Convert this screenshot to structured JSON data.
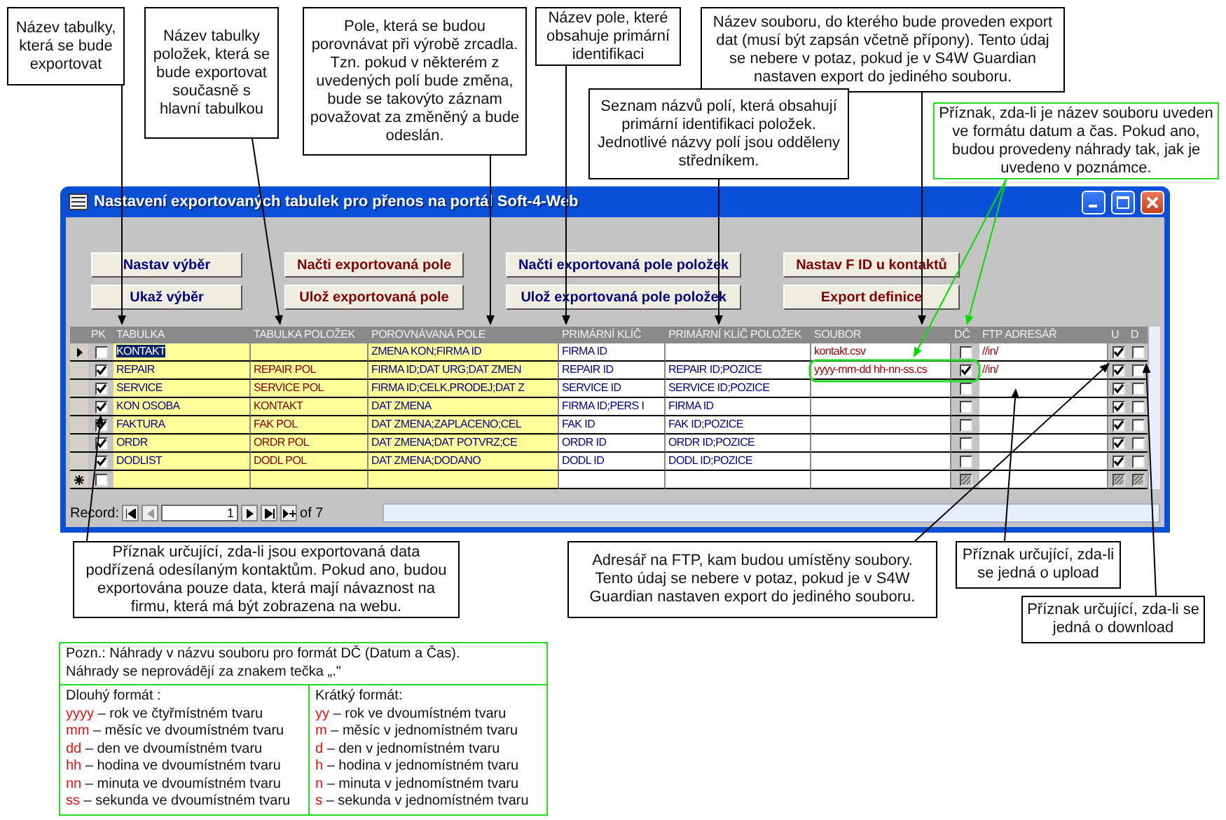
{
  "top_callouts": [
    {
      "text": "Název tabulky, která se bude exportovat",
      "kind": "plain"
    },
    {
      "text": "Název tabulky položek, která se bude exportovat současně s hlavní tabulkou",
      "kind": "plain"
    },
    {
      "text": "Pole, která se budou porovnávat při výrobě zrcadla. Tzn. pokud v některém z uvedených polí bude změna, bude se takovýto záznam považovat za změněný a bude odeslán.",
      "kind": "plain"
    },
    {
      "text": "Název pole, které obsahuje primární identifikaci",
      "kind": "plain"
    },
    {
      "text": "Název souboru, do kterého bude proveden export dat (musí být zapsán včetně přípony). Tento údaj se nebere v potaz, pokud je v S4W Guardian nastaven export do jediného souboru.",
      "kind": "plain"
    },
    {
      "text": "Seznam názvů polí, která obsahují primární identifikaci položek. Jednotlivé názvy polí jsou odděleny středníkem.",
      "kind": "plain"
    },
    {
      "text": "Příznak, zda-li je název souboru uveden ve formátu datum a čas. Pokud ano, budou provedeny náhrady tak, jak je uvedeno v poznámce.",
      "kind": "highlight"
    }
  ],
  "window": {
    "title": "Nastavení exportovaných tabulek pro přenos na portál Soft-4-Web",
    "buttons": [
      {
        "label": "Nastav výběr",
        "color": "#000080"
      },
      {
        "label": "Ukaž výběr",
        "color": "#000080"
      },
      {
        "label": "Načti exportovaná pole",
        "color": "#800000"
      },
      {
        "label": "Ulož exportovaná pole",
        "color": "#800000"
      },
      {
        "label": "Načti exportovaná pole položek",
        "color": "#000080"
      },
      {
        "label": "Ulož exportovaná pole položek",
        "color": "#000080"
      },
      {
        "label": "Nastav F ID u kontaktů",
        "color": "#800000"
      },
      {
        "label": "Export definice",
        "color": "#800000"
      }
    ],
    "table": {
      "columns": [
        "PK",
        "TABULKA",
        "TABULKA POLOŽEK",
        "POROVNÁVANÁ POLE",
        "PRIMÁRNÍ KLÍČ",
        "PRIMÁRNÍ KLÍČ POLOŽEK",
        "SOUBOR",
        "DČ",
        "FTP ADRESÁŘ",
        "U",
        "D"
      ],
      "rows": [
        {
          "kind": "record",
          "current": true,
          "pk": false,
          "tabulka": "KONTAKT",
          "tabulka_polozek": "",
          "porovnavana_pole": "ZMENA KON;FIRMA ID",
          "primarni_klic": "FIRMA ID",
          "primarni_klic_polozek": "",
          "soubor": "kontakt.csv",
          "dc": false,
          "ftp_adresar": "//in/",
          "u": true,
          "d": false,
          "circled": false
        },
        {
          "kind": "record",
          "current": false,
          "pk": true,
          "tabulka": "REPAIR",
          "tabulka_polozek": "REPAIR POL",
          "porovnavana_pole": "FIRMA ID;DAT URG;DAT ZMEN",
          "primarni_klic": "REPAIR ID",
          "primarni_klic_polozek": "REPAIR ID;POZICE",
          "soubor": "yyyy-mm-dd hh-nn-ss.cs",
          "dc": true,
          "ftp_adresar": "//in/",
          "u": true,
          "d": false,
          "circled": true
        },
        {
          "kind": "record",
          "current": false,
          "pk": true,
          "tabulka": "SERVICE",
          "tabulka_polozek": "SERVICE POL",
          "porovnavana_pole": "FIRMA ID;CELK.PRODEJ;DAT Z",
          "primarni_klic": "SERVICE ID",
          "primarni_klic_polozek": "SERVICE ID;POZICE",
          "soubor": "",
          "dc": false,
          "ftp_adresar": "",
          "u": true,
          "d": false,
          "circled": false
        },
        {
          "kind": "record",
          "current": false,
          "pk": true,
          "tabulka": "KON OSOBA",
          "tabulka_polozek": "KONTAKT",
          "porovnavana_pole": "DAT ZMENA",
          "primarni_klic": "FIRMA ID;PERS I",
          "primarni_klic_polozek": "FIRMA ID",
          "soubor": "",
          "dc": false,
          "ftp_adresar": "",
          "u": true,
          "d": false,
          "circled": false
        },
        {
          "kind": "record",
          "current": false,
          "pk": true,
          "tabulka": "FAKTURA",
          "tabulka_polozek": "FAK POL",
          "porovnavana_pole": "DAT ZMENA;ZAPLACENO;CEL",
          "primarni_klic": "FAK ID",
          "primarni_klic_polozek": "FAK ID;POZICE",
          "soubor": "",
          "dc": false,
          "ftp_adresar": "",
          "u": true,
          "d": false,
          "circled": false
        },
        {
          "kind": "record",
          "current": false,
          "pk": true,
          "tabulka": "ORDR",
          "tabulka_polozek": "ORDR POL",
          "porovnavana_pole": "DAT ZMENA;DAT POTVRZ;CE",
          "primarni_klic": "ORDR ID",
          "primarni_klic_polozek": "ORDR ID;POZICE",
          "soubor": "",
          "dc": false,
          "ftp_adresar": "",
          "u": true,
          "d": false,
          "circled": false
        },
        {
          "kind": "record",
          "current": false,
          "pk": true,
          "tabulka": "DODLIST",
          "tabulka_polozek": "DODL POL",
          "porovnavana_pole": "DAT ZMENA;DODANO",
          "primarni_klic": "DODL ID",
          "primarni_klic_polozek": "DODL ID;POZICE",
          "soubor": "",
          "dc": false,
          "ftp_adresar": "",
          "u": true,
          "d": false,
          "circled": false
        },
        {
          "kind": "new",
          "pk": false,
          "flags_greyed": true
        }
      ]
    },
    "navigator": {
      "label": "Record:",
      "current": "1",
      "total": "of 7"
    }
  },
  "bottom_callouts": [
    {
      "text": "Příznak určující, zda-li jsou exportovaná data podřízená odesílaným kontaktům. Pokud ano, budou exportována pouze data, která mají návaznost na firmu, která má být zobrazena na webu.",
      "kind": "plain"
    },
    {
      "text": "Adresář na FTP, kam budou umístěny soubory. Tento údaj se nebere v potaz, pokud je v S4W Guardian nastaven export do jediného souboru.",
      "kind": "plain"
    },
    {
      "text": "Příznak určující, zda-li se jedná o upload",
      "kind": "plain"
    },
    {
      "text": "Příznak určující, zda-li se jedná o download",
      "kind": "plain"
    }
  ],
  "note": {
    "lines": [
      "Pozn.: Náhrady v názvu souboru pro formát DČ (Datum a Čas).",
      "Náhrady se neprovádějí za znakem tečka „.\""
    ],
    "columns": [
      {
        "title": "Dlouhý formát :",
        "items": [
          {
            "code": "yyyy",
            "text": "– rok ve čtyřmístném tvaru"
          },
          {
            "code": "mm",
            "text": "– měsíc ve dvoumístném tvaru"
          },
          {
            "code": "dd",
            "text": "– den ve dvoumístném tvaru"
          },
          {
            "code": "hh",
            "text": "– hodina ve dvoumístném tvaru"
          },
          {
            "code": "nn",
            "text": "– minuta ve dvoumístném tvaru"
          },
          {
            "code": "ss",
            "text": "– sekunda ve dvoumístném tvaru"
          }
        ]
      },
      {
        "title": "Krátký formát:",
        "items": [
          {
            "code": "yy",
            "text": "– rok ve dvoumístném tvaru"
          },
          {
            "code": "m",
            "text": "– měsíc v jednomístném tvaru"
          },
          {
            "code": "d",
            "text": "– den v jednomístném tvaru"
          },
          {
            "code": "h",
            "text": "– hodina v jednomístném tvaru"
          },
          {
            "code": "n",
            "text": "– minuta v jednomístném tvaru"
          },
          {
            "code": "s",
            "text": "– sekunda v jednomístném tvaru"
          }
        ]
      }
    ]
  }
}
